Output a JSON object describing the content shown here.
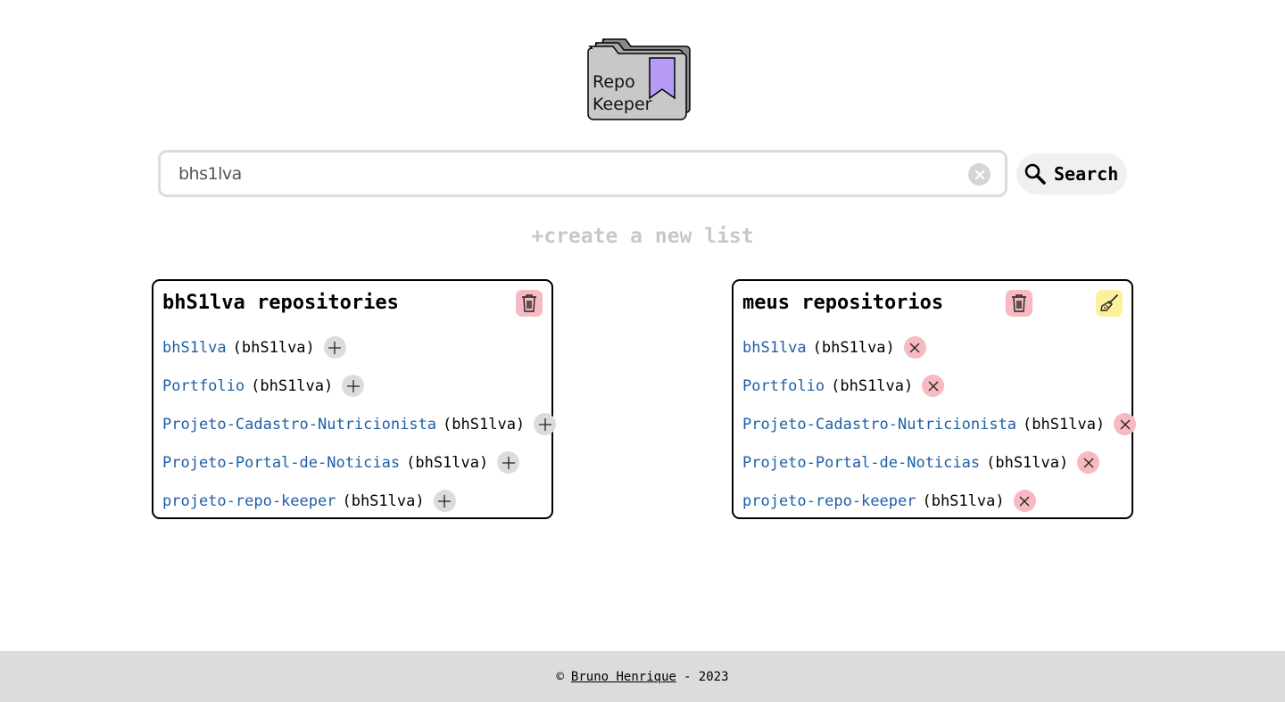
{
  "logo": {
    "line1": "Repo",
    "line2": "Keeper",
    "folder_color": "#c8c8c8",
    "bookmark_color": "#b79cf7"
  },
  "search": {
    "value": "bhs1lva",
    "placeholder": "",
    "button_label": "Search"
  },
  "create_list_label": "+create a new list",
  "lists": [
    {
      "title": "bhS1lva repositories",
      "action": "add",
      "repos": [
        {
          "name": "bhS1lva",
          "owner": "(bhS1lva)"
        },
        {
          "name": "Portfolio",
          "owner": "(bhS1lva)"
        },
        {
          "name": "Projeto-Cadastro-Nutricionista",
          "owner": "(bhS1lva)"
        },
        {
          "name": "Projeto-Portal-de-Noticias",
          "owner": "(bhS1lva)"
        },
        {
          "name": "projeto-repo-keeper",
          "owner": "(bhS1lva)"
        }
      ]
    },
    {
      "title": "meus repositorios",
      "action": "remove",
      "repos": [
        {
          "name": "bhS1lva",
          "owner": "(bhS1lva)"
        },
        {
          "name": "Portfolio",
          "owner": "(bhS1lva)"
        },
        {
          "name": "Projeto-Cadastro-Nutricionista",
          "owner": "(bhS1lva)"
        },
        {
          "name": "Projeto-Portal-de-Noticias",
          "owner": "(bhS1lva)"
        },
        {
          "name": "projeto-repo-keeper",
          "owner": "(bhS1lva)"
        }
      ]
    }
  ],
  "footer": {
    "copyright": "©",
    "author": "Bruno Henrique",
    "year_text": "- 2023"
  },
  "colors": {
    "link": "#1e5fa6",
    "trash_bg": "#f7b9c2",
    "broom_bg": "#fbf09c",
    "add_bg": "#dcdcdc",
    "footer_bg": "#dcdcdc"
  }
}
